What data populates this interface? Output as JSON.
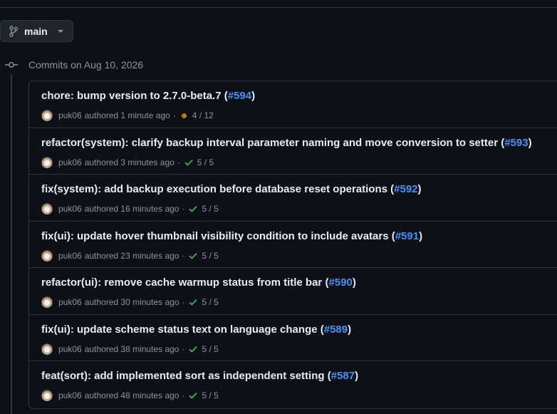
{
  "branch": {
    "name": "main",
    "icon": "git-branch-icon"
  },
  "group": {
    "title": "Commits on Aug 10, 2026"
  },
  "colors": {
    "background": "#0d1117",
    "border": "#30363d",
    "text": "#e6edf3",
    "muted": "#8b949e",
    "link": "#4493f8",
    "success": "#3fb950",
    "pending": "#bb8009"
  },
  "commits": [
    {
      "title": "chore: bump version to 2.7.0-beta.7 (",
      "pr": "#594",
      "close": ")",
      "author": "puk06",
      "authored": "authored 1 minute ago",
      "sep": "·",
      "status": "pending",
      "checks": "4 / 12"
    },
    {
      "title": "refactor(system): clarify backup interval parameter naming and move conversion to setter (",
      "pr": "#593",
      "close": ")",
      "author": "puk06",
      "authored": "authored 3 minutes ago",
      "sep": "·",
      "status": "success",
      "checks": "5 / 5"
    },
    {
      "title": "fix(system): add backup execution before database reset operations (",
      "pr": "#592",
      "close": ")",
      "author": "puk06",
      "authored": "authored 16 minutes ago",
      "sep": "·",
      "status": "success",
      "checks": "5 / 5"
    },
    {
      "title": "fix(ui): update hover thumbnail visibility condition to include avatars (",
      "pr": "#591",
      "close": ")",
      "author": "puk06",
      "authored": "authored 23 minutes ago",
      "sep": "·",
      "status": "success",
      "checks": "5 / 5"
    },
    {
      "title": "refactor(ui): remove cache warmup status from title bar (",
      "pr": "#590",
      "close": ")",
      "author": "puk06",
      "authored": "authored 30 minutes ago",
      "sep": "·",
      "status": "success",
      "checks": "5 / 5"
    },
    {
      "title": "fix(ui): update scheme status text on language change (",
      "pr": "#589",
      "close": ")",
      "author": "puk06",
      "authored": "authored 38 minutes ago",
      "sep": "·",
      "status": "success",
      "checks": "5 / 5"
    },
    {
      "title": "feat(sort): add implemented sort as independent setting (",
      "pr": "#587",
      "close": ")",
      "author": "puk06",
      "authored": "authored 48 minutes ago",
      "sep": "·",
      "status": "success",
      "checks": "5 / 5"
    }
  ]
}
